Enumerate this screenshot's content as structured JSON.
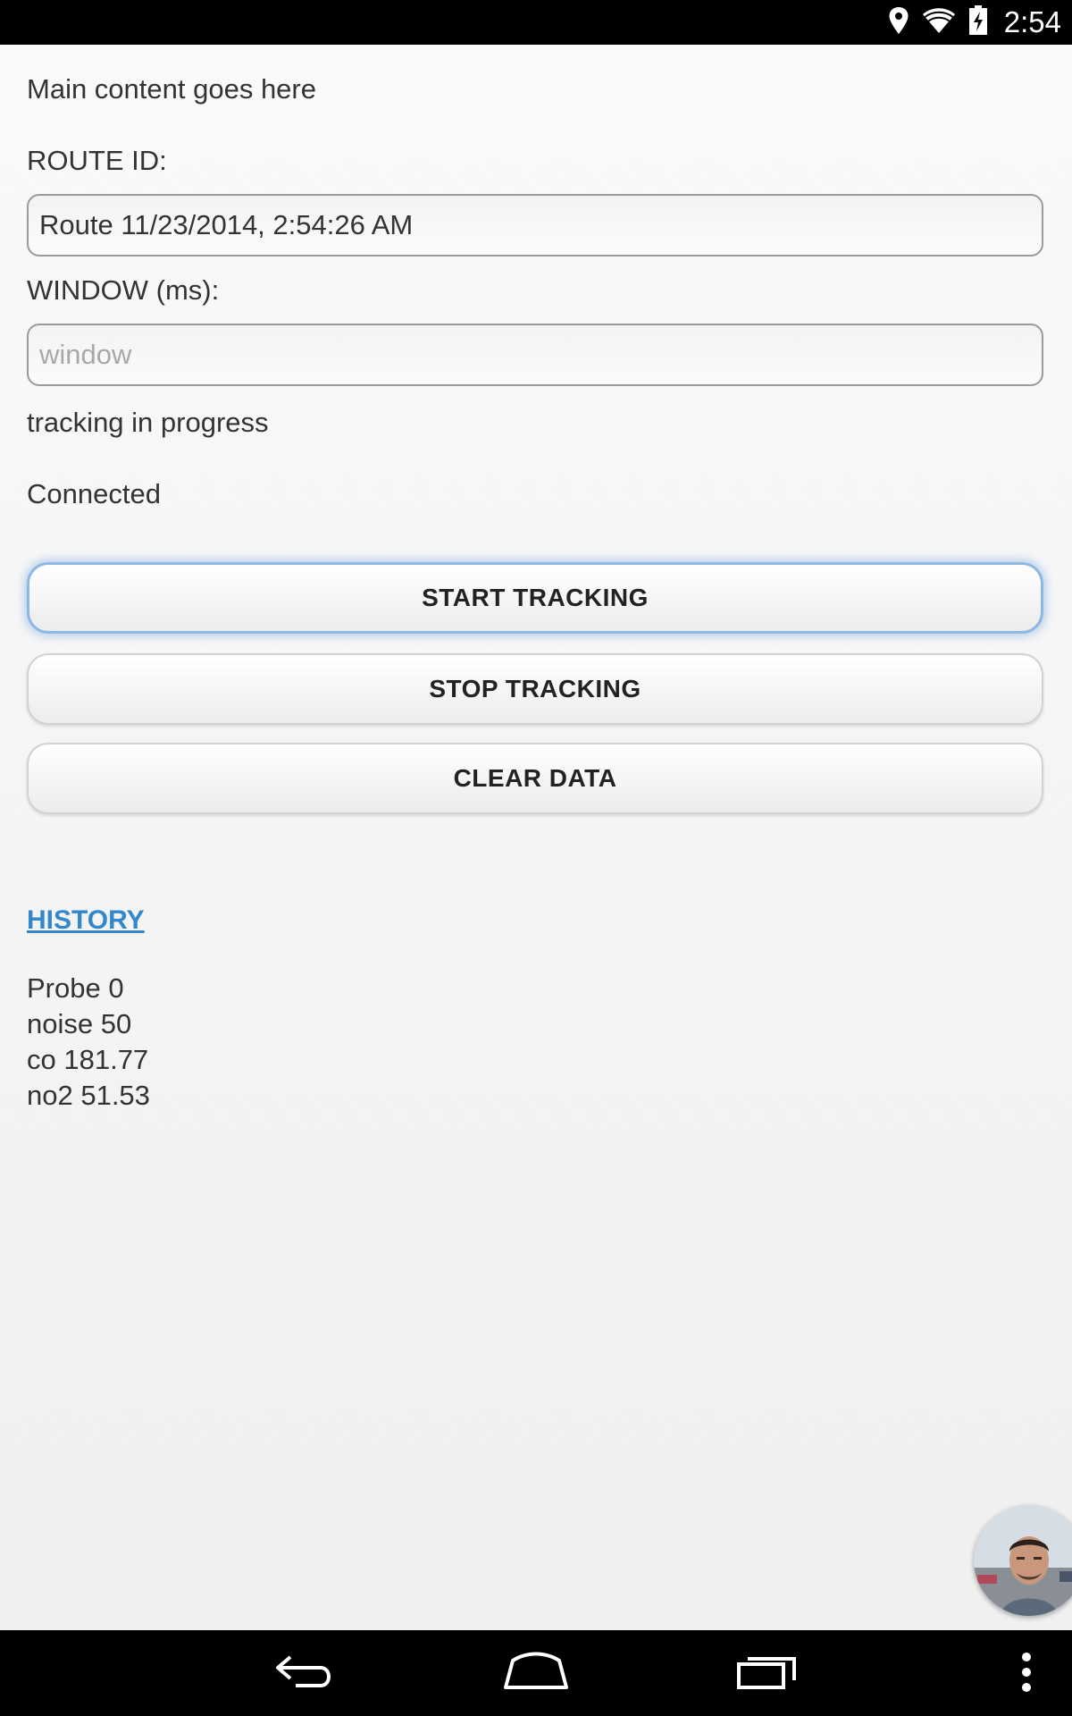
{
  "status_bar": {
    "time": "2:54",
    "icons": [
      "location-icon",
      "wifi-icon",
      "battery-charging-icon"
    ]
  },
  "main": {
    "intro_text": "Main content goes here",
    "route_id": {
      "label": "ROUTE ID:",
      "value": "Route 11/23/2014, 2:54:26 AM"
    },
    "window": {
      "label": "WINDOW (ms):",
      "placeholder": "window"
    },
    "tracking_status": "tracking in progress",
    "connection_status": "Connected",
    "buttons": {
      "start": "START TRACKING",
      "stop": "STOP TRACKING",
      "clear": "CLEAR DATA"
    },
    "history_link": "HISTORY",
    "readings": [
      "Probe 0",
      "noise 50",
      "co 181.77",
      "no2 51.53"
    ]
  },
  "nav_bar": {
    "icons": [
      "back-icon",
      "home-icon",
      "recent-apps-icon",
      "overflow-menu-icon"
    ]
  },
  "colors": {
    "link": "#3388cc",
    "focus_ring": "#8eb8e4"
  }
}
